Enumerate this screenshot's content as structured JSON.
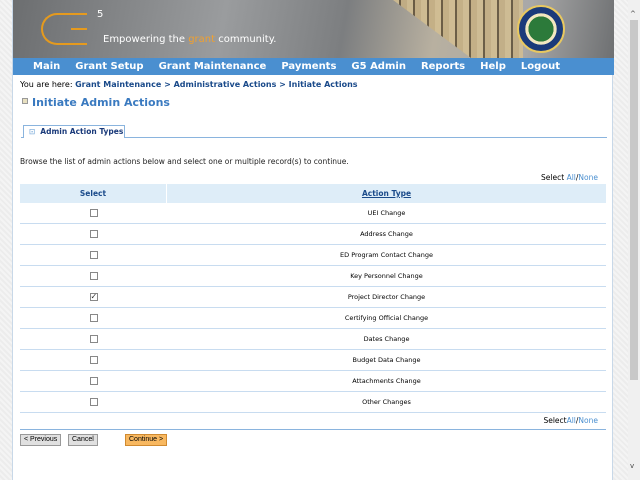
{
  "banner": {
    "logo": "G",
    "logo_superscript": "5",
    "tagline_before": "Empowering the ",
    "tagline_highlight": "grant",
    "tagline_after": " community."
  },
  "nav": [
    "Main",
    "Grant Setup",
    "Grant Maintenance",
    "Payments",
    "G5 Admin",
    "Reports",
    "Help",
    "Logout"
  ],
  "breadcrumb": {
    "prefix": "You are here: ",
    "items": [
      "Grant Maintenance",
      "Administrative Actions",
      "Initiate Actions"
    ],
    "separator": " > "
  },
  "page_title": "Initiate Admin Actions",
  "tab": "Admin Action Types",
  "instructions": "Browse the list of admin actions below and select one or multiple record(s) to continue.",
  "select_all": {
    "label": "Select ",
    "all": "All",
    "sep": "/",
    "none": "None"
  },
  "table": {
    "headers": [
      "Select",
      "Action Type"
    ],
    "rows": [
      {
        "action": "UEI Change",
        "checked": false
      },
      {
        "action": "Address Change",
        "checked": false
      },
      {
        "action": "ED Program Contact Change",
        "checked": false
      },
      {
        "action": "Key Personnel Change",
        "checked": false
      },
      {
        "action": "Project Director Change",
        "checked": true
      },
      {
        "action": "Certifying Official Change",
        "checked": false
      },
      {
        "action": "Dates Change",
        "checked": false
      },
      {
        "action": "Budget Data Change",
        "checked": false
      },
      {
        "action": "Attachments Change",
        "checked": false
      },
      {
        "action": "Other Changes",
        "checked": false
      }
    ]
  },
  "buttons": {
    "previous": "< Previous",
    "cancel": "Cancel",
    "continue": "Continue >"
  },
  "colors": {
    "nav": "#4a8fd0",
    "accent": "#e59a1e",
    "title": "#3a7ac0",
    "continue_button": "#f8b860"
  }
}
